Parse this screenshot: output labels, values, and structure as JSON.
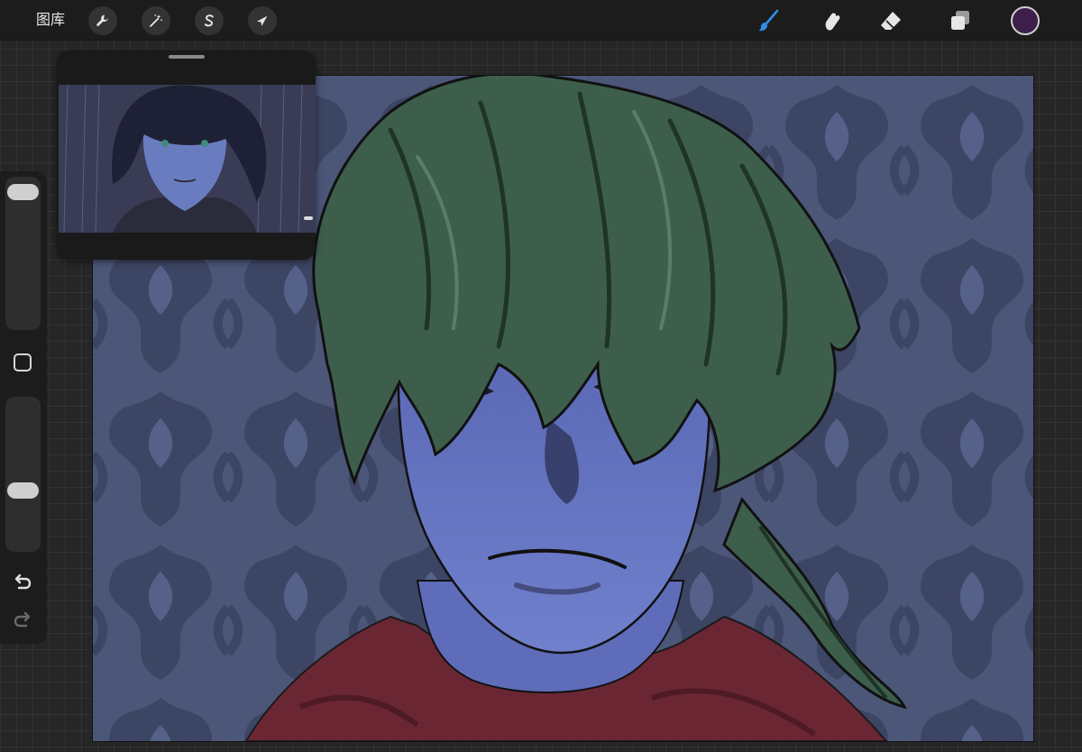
{
  "toolbar": {
    "gallery_label": "图库",
    "left_tools": [
      {
        "icon": "wrench-icon",
        "name": "actions"
      },
      {
        "icon": "magic-wand-icon",
        "name": "adjustments"
      },
      {
        "icon": "selection-s-icon",
        "name": "selection"
      },
      {
        "icon": "arrow-cursor-icon",
        "name": "transform"
      }
    ],
    "right_tools": [
      {
        "icon": "brush-icon",
        "name": "paint",
        "active": true
      },
      {
        "icon": "smudge-icon",
        "name": "smudge",
        "active": false
      },
      {
        "icon": "eraser-icon",
        "name": "erase",
        "active": false
      },
      {
        "icon": "layers-icon",
        "name": "layers",
        "active": false
      }
    ],
    "current_color": "#3d1f4a"
  },
  "sidebar": {
    "brush_size_level": 0.97,
    "opacity_level": 0.38,
    "undo_icon": "undo-icon",
    "redo_icon": "redo-icon",
    "modify_icon": "square-icon"
  },
  "colors": {
    "accent": "#2f8ee8",
    "canvas_background": "#4a5577",
    "hair": "#3e5e4c",
    "skin": "#6c7cc8",
    "scarf": "#6a2733"
  }
}
